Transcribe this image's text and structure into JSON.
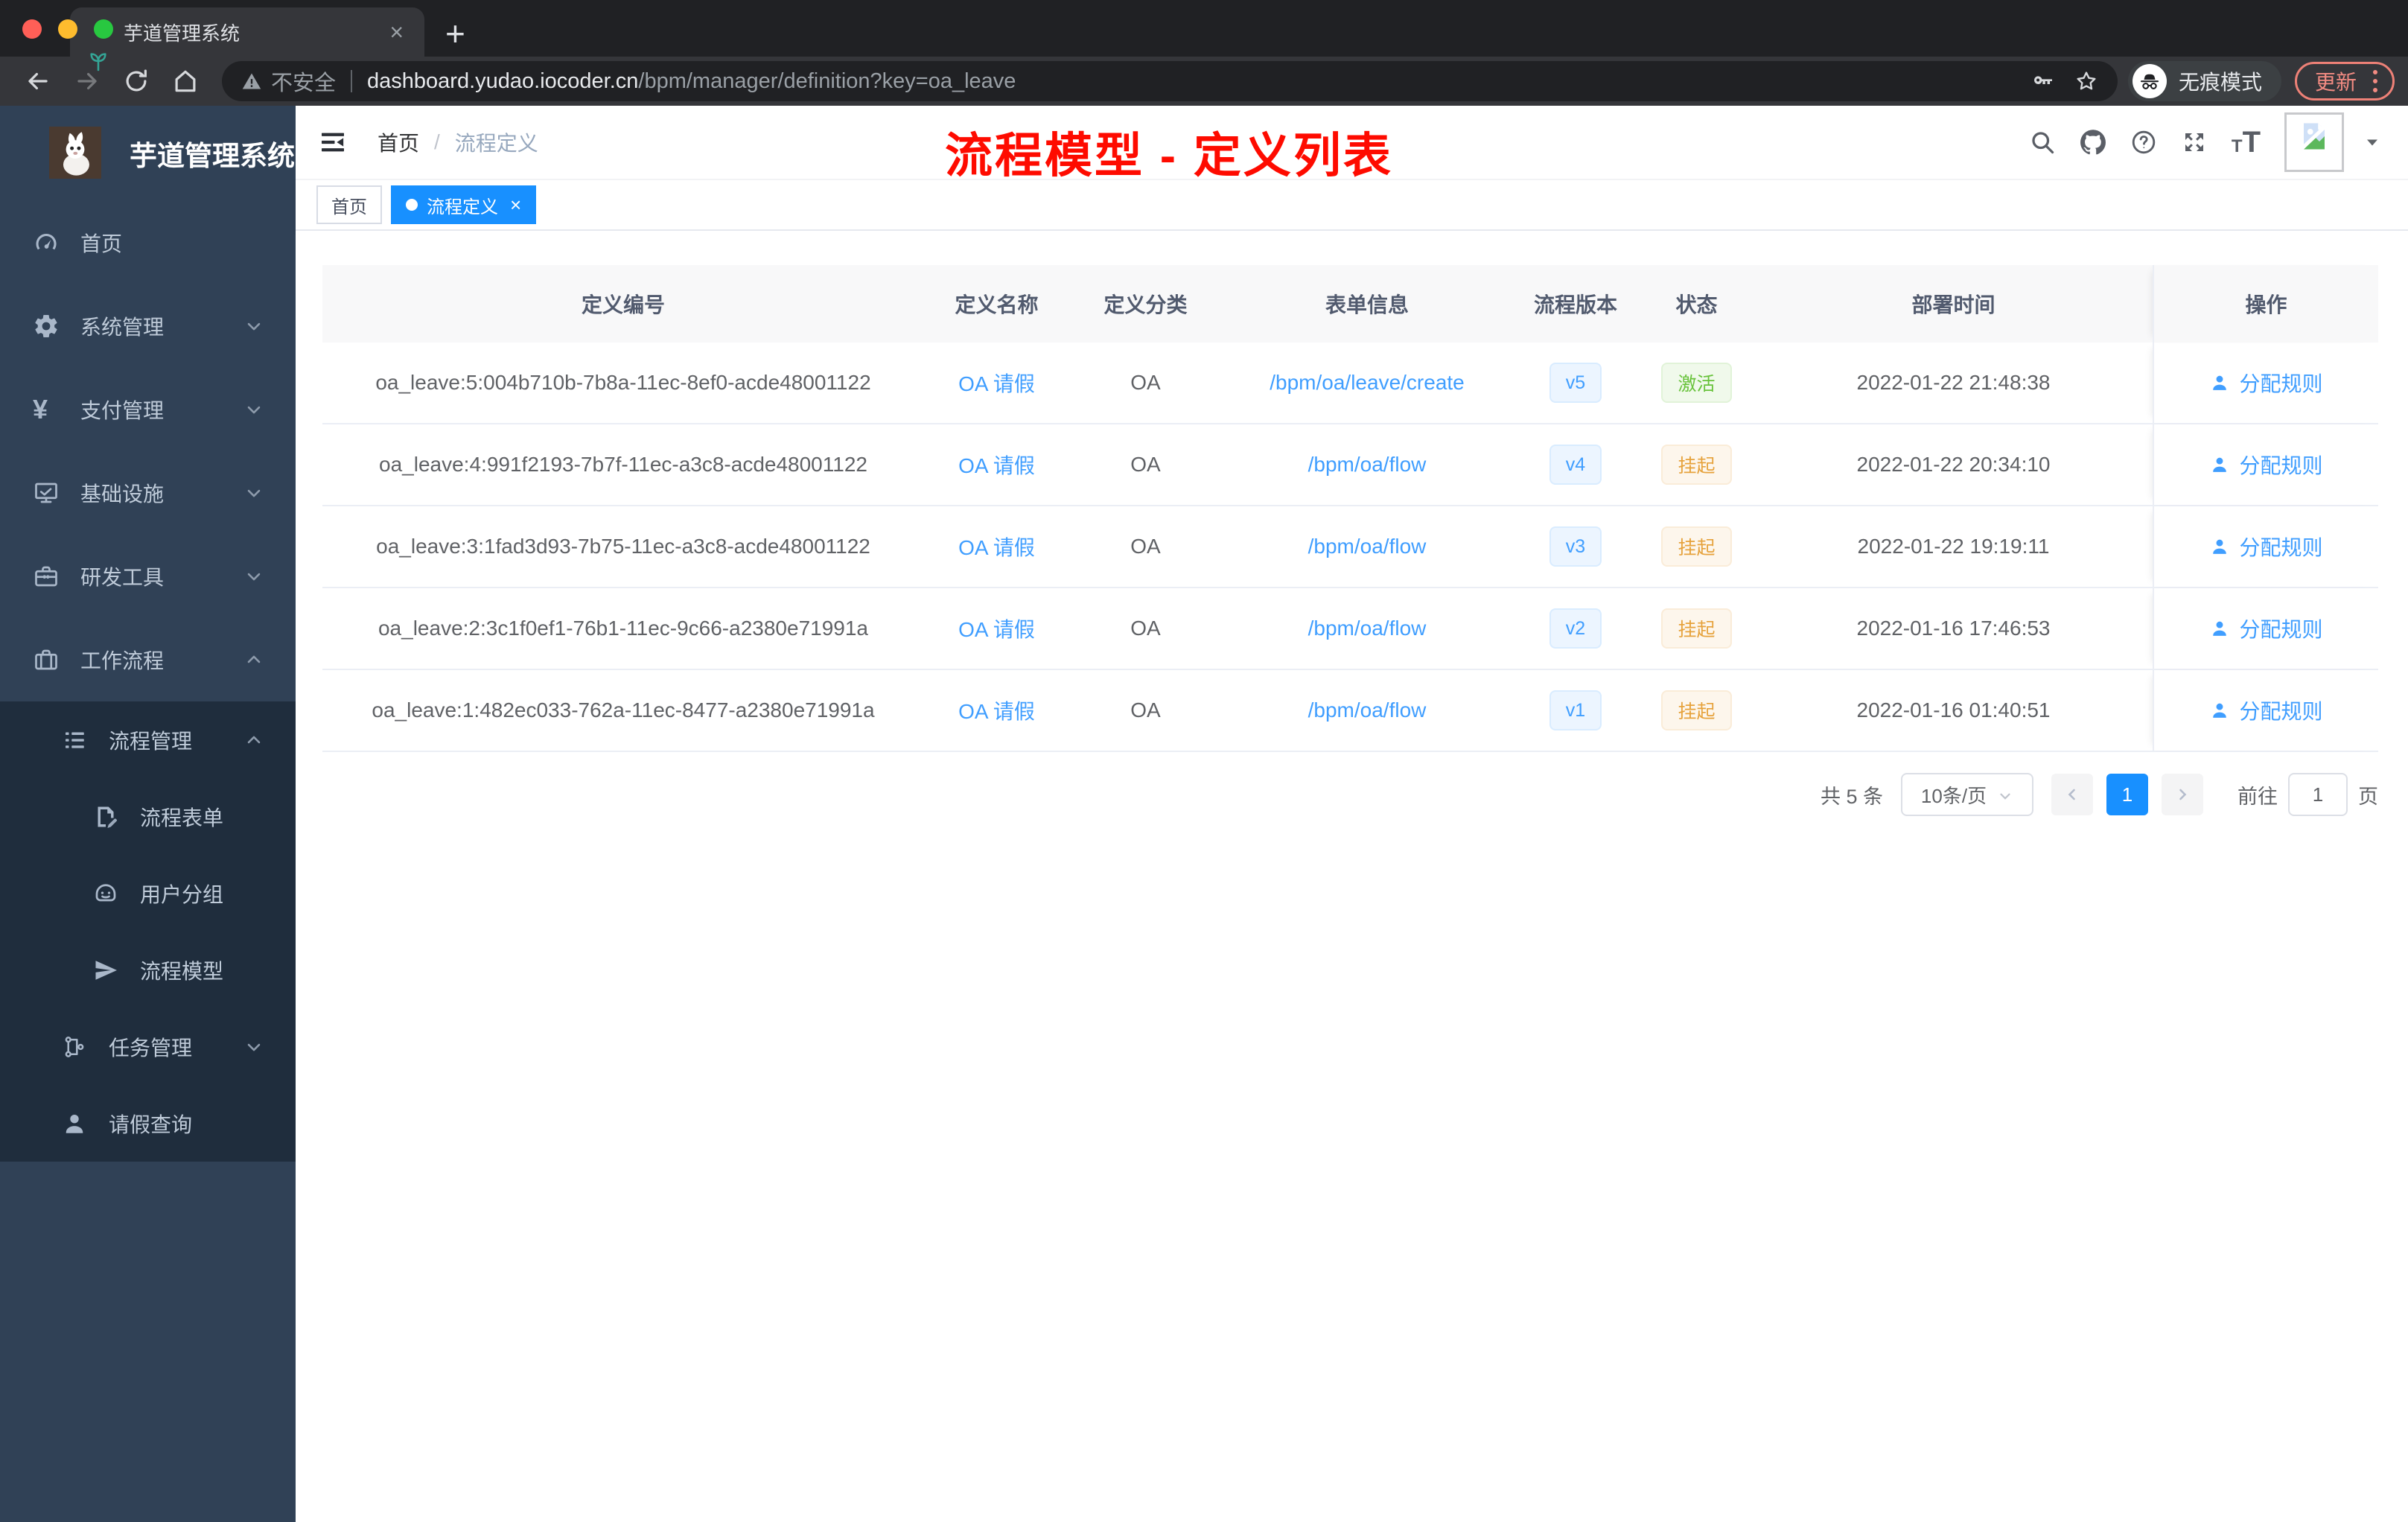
{
  "browser": {
    "tab_title": "芋道管理系统",
    "security_label": "不安全",
    "url_host": "dashboard.yudao.iocoder.cn",
    "url_path": "/bpm/manager/definition?key=oa_leave",
    "incognito_label": "无痕模式",
    "update_label": "更新"
  },
  "sidebar": {
    "logo_title": "芋道管理系统",
    "menu": [
      {
        "label": "首页",
        "icon": "dashboard-icon",
        "level": 1
      },
      {
        "label": "系统管理",
        "icon": "gear-icon",
        "level": 1,
        "chevron": "down"
      },
      {
        "label": "支付管理",
        "icon": "yen-icon",
        "level": 1,
        "chevron": "down"
      },
      {
        "label": "基础设施",
        "icon": "monitor-icon",
        "level": 1,
        "chevron": "down"
      },
      {
        "label": "研发工具",
        "icon": "toolbox-icon",
        "level": 1,
        "chevron": "down"
      },
      {
        "label": "工作流程",
        "icon": "suitcase-icon",
        "level": 1,
        "chevron": "up"
      },
      {
        "label": "流程管理",
        "icon": "list-icon",
        "level": 2,
        "chevron": "up",
        "dark": true
      },
      {
        "label": "流程表单",
        "icon": "form-icon",
        "level": 3,
        "dark": true
      },
      {
        "label": "用户分组",
        "icon": "face-icon",
        "level": 3,
        "dark": true
      },
      {
        "label": "流程模型",
        "icon": "send-icon",
        "level": 3,
        "dark": true
      },
      {
        "label": "任务管理",
        "icon": "tree-icon",
        "level": 2,
        "chevron": "down",
        "dark": true
      },
      {
        "label": "请假查询",
        "icon": "user-icon",
        "level": 2,
        "dark": true
      }
    ]
  },
  "header": {
    "breadcrumb": [
      "首页",
      "流程定义"
    ],
    "annotation": "流程模型 - 定义列表"
  },
  "tags": [
    {
      "label": "首页",
      "active": false,
      "closable": false
    },
    {
      "label": "流程定义",
      "active": true,
      "closable": true
    }
  ],
  "table": {
    "columns": [
      "定义编号",
      "定义名称",
      "定义分类",
      "表单信息",
      "流程版本",
      "状态",
      "部署时间",
      "操作"
    ],
    "action_label": "分配规则",
    "rows": [
      {
        "id": "oa_leave:5:004b710b-7b8a-11ec-8ef0-acde48001122",
        "name": "OA 请假",
        "category": "OA",
        "form": "/bpm/oa/leave/create",
        "version": "v5",
        "status": "激活",
        "status_type": "active",
        "deploy_time": "2022-01-22 21:48:38"
      },
      {
        "id": "oa_leave:4:991f2193-7b7f-11ec-a3c8-acde48001122",
        "name": "OA 请假",
        "category": "OA",
        "form": "/bpm/oa/flow",
        "version": "v4",
        "status": "挂起",
        "status_type": "suspended",
        "deploy_time": "2022-01-22 20:34:10"
      },
      {
        "id": "oa_leave:3:1fad3d93-7b75-11ec-a3c8-acde48001122",
        "name": "OA 请假",
        "category": "OA",
        "form": "/bpm/oa/flow",
        "version": "v3",
        "status": "挂起",
        "status_type": "suspended",
        "deploy_time": "2022-01-22 19:19:11"
      },
      {
        "id": "oa_leave:2:3c1f0ef1-76b1-11ec-9c66-a2380e71991a",
        "name": "OA 请假",
        "category": "OA",
        "form": "/bpm/oa/flow",
        "version": "v2",
        "status": "挂起",
        "status_type": "suspended",
        "deploy_time": "2022-01-16 17:46:53"
      },
      {
        "id": "oa_leave:1:482ec033-762a-11ec-8477-a2380e71991a",
        "name": "OA 请假",
        "category": "OA",
        "form": "/bpm/oa/flow",
        "version": "v1",
        "status": "挂起",
        "status_type": "suspended",
        "deploy_time": "2022-01-16 01:40:51"
      }
    ]
  },
  "pagination": {
    "total_label": "共 5 条",
    "page_size_label": "10条/页",
    "current_page": "1",
    "goto_label": "前往",
    "page_unit_label": "页"
  },
  "colors": {
    "primary": "#1890ff",
    "link": "#409eff",
    "success": "#67c23a",
    "warning": "#e6a23c",
    "annotation_red": "#fe0b00",
    "sidebar_bg": "#304156",
    "sidebar_sub_bg": "#1f2d3d"
  }
}
